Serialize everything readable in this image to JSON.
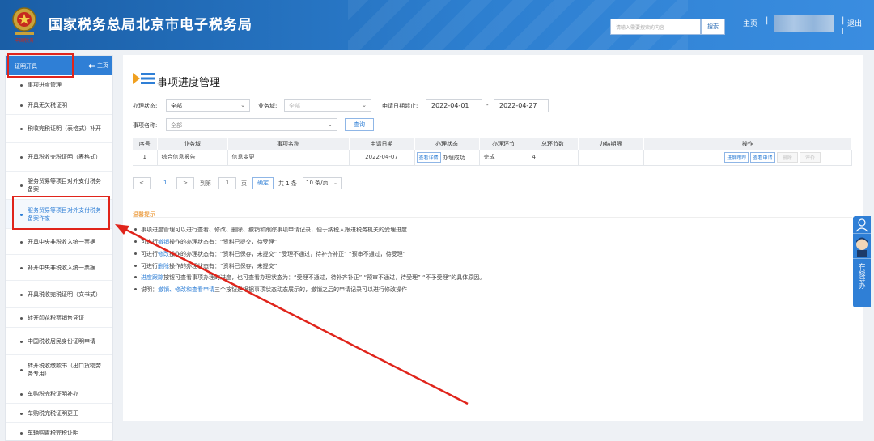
{
  "header": {
    "title": "国家税务总局北京市电子税务局",
    "emblem_caption": "中国税务",
    "search_placeholder": "请输入需要搜索的内容",
    "search_button": "搜索",
    "home_link": "主页",
    "separator": "|",
    "logout_link": "退出"
  },
  "sidebar": {
    "head_label": "证明开具",
    "home_label": "主页",
    "items": [
      {
        "label": "事项进度管理"
      },
      {
        "label": "开具无欠税证明"
      },
      {
        "label": "税收完税证明（表格式）补开"
      },
      {
        "label": "开具税收完税证明（表格式）"
      },
      {
        "label": "服务贸易等项目对外支付税务备案"
      },
      {
        "label": "服务贸易等项目对外支付税务备案作废"
      },
      {
        "label": "开具中央非税收入统一票据"
      },
      {
        "label": "补开中央非税收入统一票据"
      },
      {
        "label": "开具税收完税证明（文书式）"
      },
      {
        "label": "转开印花税票销售凭证"
      },
      {
        "label": "中国税收居民身份证明申请"
      },
      {
        "label": "转开税收缴款书（出口货物劳务专用）"
      },
      {
        "label": "车购税完税证明补办"
      },
      {
        "label": "车购税完税证明更正"
      },
      {
        "label": "车辆购置税完税证明"
      }
    ]
  },
  "main": {
    "page_title": "事项进度管理",
    "filters": {
      "status_label": "办理状态:",
      "status_value": "全部",
      "domain_label": "业务域:",
      "domain_value": "全部",
      "date_label": "申请日期起止:",
      "date_from": "2022-04-01",
      "date_sep": "-",
      "date_to": "2022-04-27",
      "item_label": "事项名称:",
      "item_value": "全部",
      "query_button": "查询"
    },
    "table": {
      "headers": [
        "序号",
        "业务域",
        "事项名称",
        "申请日期",
        "办理状态",
        "办理环节",
        "总环节数",
        "办结期限",
        "操作"
      ],
      "rows": [
        {
          "index": "1",
          "domain": "综合信息报告",
          "item": "信息变更",
          "date": "2022-04-07",
          "detail_btn": "查看详情",
          "status": "办理成功...",
          "stage": "完成",
          "total": "4",
          "deadline": "",
          "actions": [
            "进度跟踪",
            "查看申请",
            "删除",
            "评价"
          ]
        }
      ]
    },
    "pager": {
      "prev": "<",
      "current_page": "1",
      "next": ">",
      "goto_label": "到第",
      "page_input": "1",
      "page_unit": "页",
      "confirm": "确定",
      "total": "共 1 条",
      "page_size": "10 条/页"
    },
    "tips": {
      "title": "温馨提示",
      "lines": [
        {
          "pre": "事项进度管理可以进行查看、修改、删除、撤销和跟踪事项申请记录，便于纳税人跟进税务机关的受理进度",
          "hl": "",
          "post": ""
        },
        {
          "pre": "可进行",
          "hl": "撤销",
          "post": "操作的办理状态有：“资料已提交，待受理”"
        },
        {
          "pre": "可进行",
          "hl": "修改",
          "post": "操作的办理状态有：“资料已保存，未提交” “受理不通过，待补齐补正” “预审不通过，待受理”"
        },
        {
          "pre": "可进行",
          "hl": "删除",
          "post": "操作的办理状态有：“资料已保存，未提交”"
        },
        {
          "pre": "",
          "hl": "进度跟踪",
          "post": "按钮可查看事项办理的进度，也可查看办理状态为：“受理不通过，待补齐补正” “预审不通过，待受理” “不予受理”的具体原因。"
        },
        {
          "pre": "说明：",
          "hl": "撤销、修改和查看申请",
          "post": "三个按钮是根据事项状态动态展示的，撤销之后的申请记录可以进行修改操作"
        }
      ]
    }
  },
  "float_widget": {
    "label": "在线导办"
  },
  "colors": {
    "brand": "#2f7fd6",
    "header": "#1a5ea6",
    "annotation": "#e0241b",
    "tip_title": "#e8891a"
  }
}
